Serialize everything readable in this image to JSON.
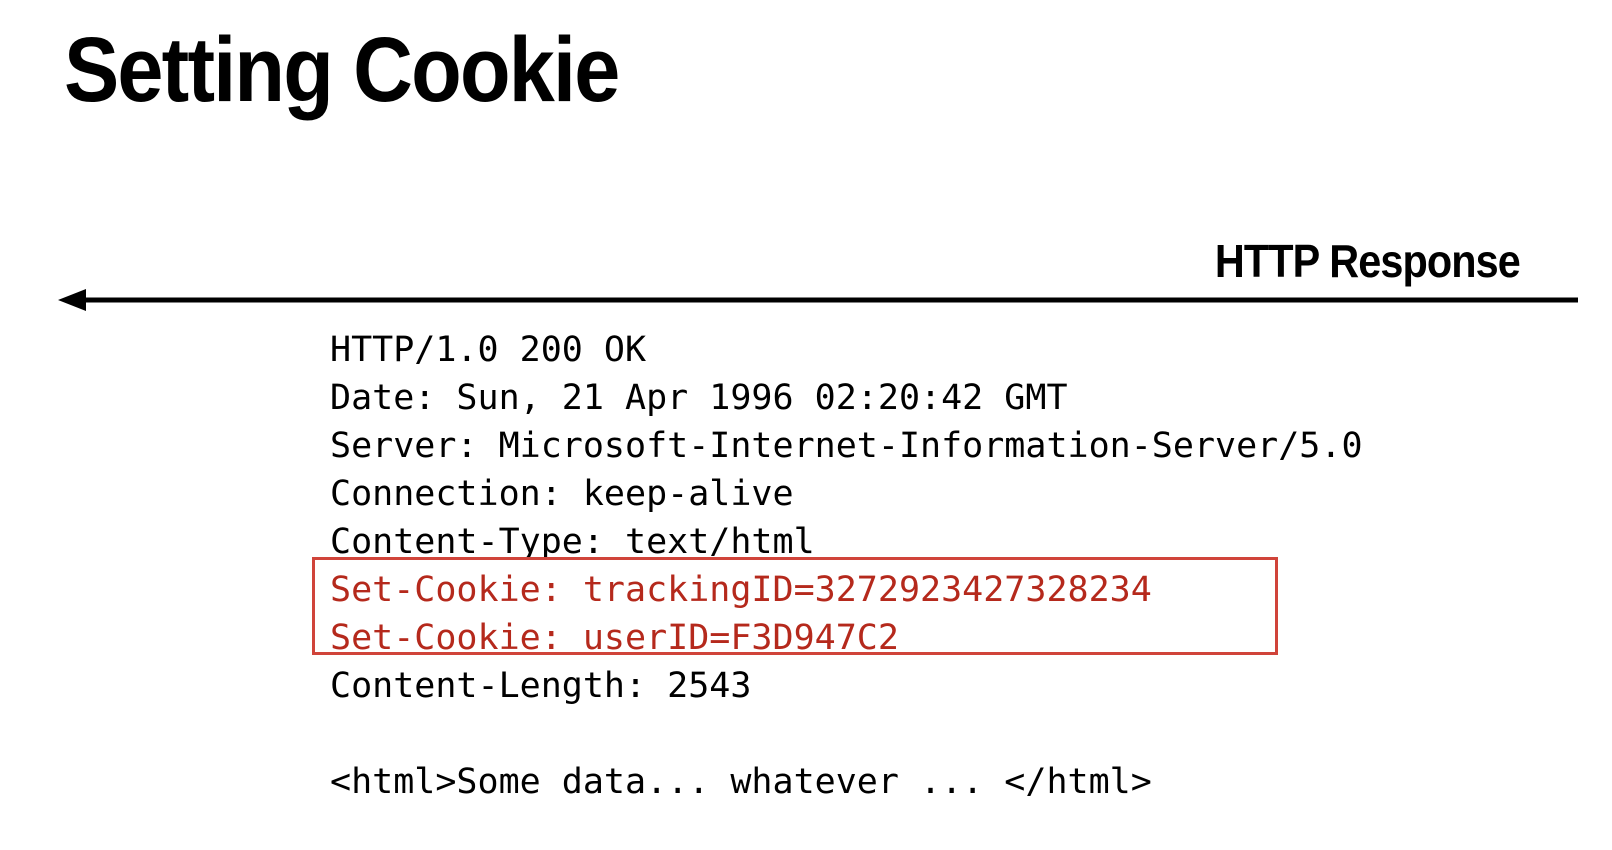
{
  "title": "Setting Cookie",
  "arrow": {
    "label": "HTTP Response",
    "direction": "left"
  },
  "response": {
    "status_line": "HTTP/1.0 200 OK",
    "headers": [
      "Date: Sun, 21 Apr 1996 02:20:42 GMT",
      "Server: Microsoft-Internet-Information-Server/5.0",
      "Connection: keep-alive",
      "Content-Type: text/html",
      "Set-Cookie: trackingID=3272923427328234",
      "Set-Cookie: userID=F3D947C2",
      "Content-Length: 2543"
    ],
    "body": "<html>Some data... whatever ... </html>"
  },
  "colors": {
    "highlight_text": "#b5291c",
    "highlight_border": "#d0443a",
    "text": "#000000",
    "background": "#ffffff"
  }
}
